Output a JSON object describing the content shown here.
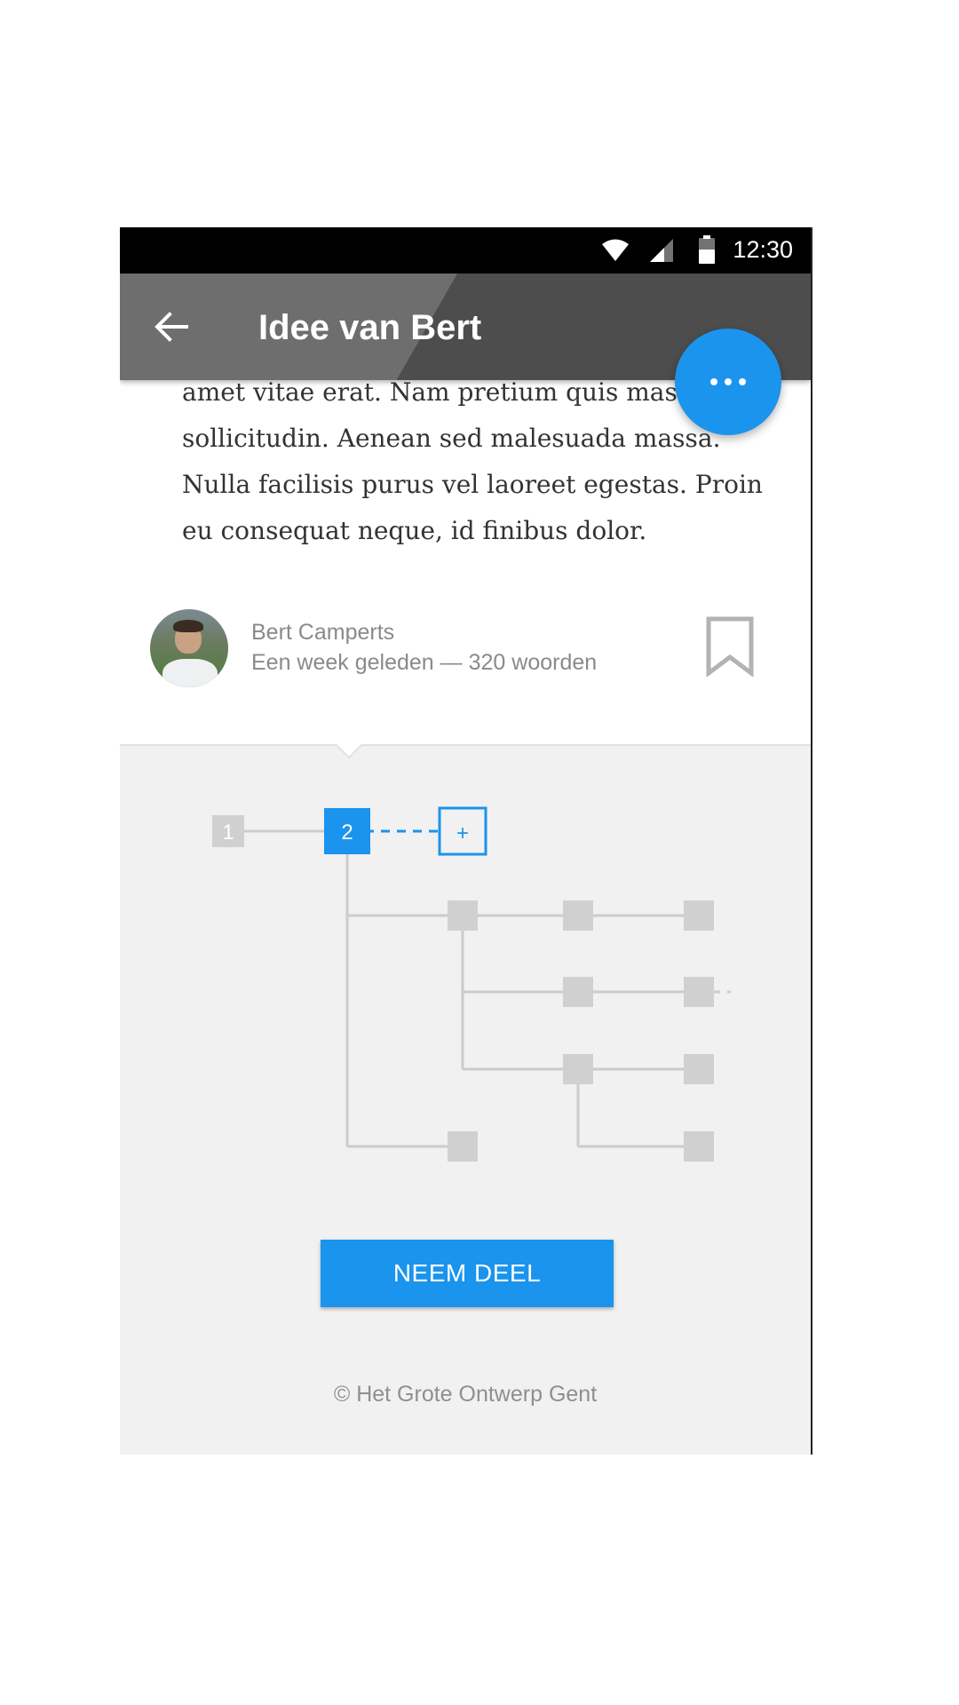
{
  "status_bar": {
    "time": "12:30"
  },
  "app_bar": {
    "title": "Idee van Bert"
  },
  "article": {
    "lines": [
      "amet vitae erat. Nam pretium quis massa",
      "sollicitudin. Aenean sed malesuada massa.",
      "Nulla facilisis purus vel laoreet egestas. Proin",
      "eu consequat neque, id finibus dolor."
    ]
  },
  "author": {
    "name": "Bert Camperts",
    "meta": "Een week geleden — 320 woorden"
  },
  "tree": {
    "nodes": {
      "first": "1",
      "current": "2",
      "add": "+"
    }
  },
  "cta": {
    "label": "NEEM DEEL"
  },
  "footer": {
    "text": "© Het Grote Ontwerp Gent"
  },
  "colors": {
    "accent": "#1a94ec",
    "appbar": "#4d4d4d",
    "node": "#d0d0d0",
    "section_bg": "#f1f1f1"
  },
  "icons": [
    "back-arrow-icon",
    "wifi-icon",
    "signal-icon",
    "battery-icon",
    "more-horizontal-icon",
    "bookmark-icon"
  ]
}
